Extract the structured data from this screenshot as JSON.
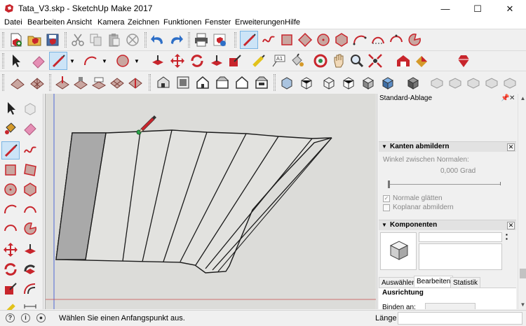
{
  "window": {
    "title": "Tata_V3.skp - SketchUp Make 2017",
    "minimize_glyph": "—",
    "maximize_glyph": "☐",
    "close_glyph": "✕"
  },
  "menu": [
    "Datei",
    "Bearbeiten",
    "Ansicht",
    "Kamera",
    "Zeichnen",
    "Funktionen",
    "Fenster",
    "Erweiterungen",
    "Hilfe"
  ],
  "tray": {
    "title": "Standard-Ablage",
    "pin_glyph": "📌",
    "close_glyph": "✕",
    "soften": {
      "header": "Kanten abmildern",
      "angle_label": "Winkel zwischen Normalen:",
      "angle_value": "0,000",
      "angle_unit": "Grad",
      "slider_value": 0,
      "smooth_normals": "Normale glätten",
      "soften_coplanar": "Koplanar abmildern"
    },
    "components": {
      "header": "Komponenten",
      "tabs": [
        "Auswählen",
        "Bearbeiten",
        "Statistik"
      ],
      "selected_tab": "Bearbeiten",
      "alignment_heading": "Ausrichtung",
      "glue_label": "Binden an:"
    }
  },
  "status": {
    "message": "Wählen Sie einen Anfangspunkt aus.",
    "length_label": "Länge",
    "length_value": ""
  },
  "colors": {
    "accent_red": "#c8252c",
    "active_tool_bg": "#cce4f7",
    "viewport_bg": "#dcdcd9"
  }
}
